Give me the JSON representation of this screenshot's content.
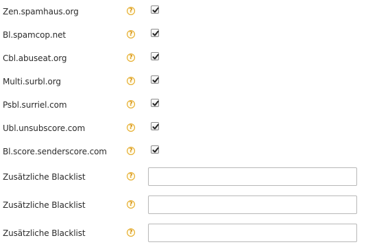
{
  "blacklists": [
    {
      "label": "Zen.spamhaus.org",
      "checked": true,
      "help_icon": "question-circle-icon"
    },
    {
      "label": "Bl.spamcop.net",
      "checked": true,
      "help_icon": "question-circle-icon"
    },
    {
      "label": "Cbl.abuseat.org",
      "checked": true,
      "help_icon": "question-circle-icon"
    },
    {
      "label": "Multi.surbl.org",
      "checked": true,
      "help_icon": "question-circle-icon"
    },
    {
      "label": "Psbl.surriel.com",
      "checked": true,
      "help_icon": "question-circle-icon"
    },
    {
      "label": "Ubl.unsubscore.com",
      "checked": true,
      "help_icon": "question-circle-icon"
    },
    {
      "label": "Bl.score.senderscore.com",
      "checked": true,
      "help_icon": "question-circle-icon"
    }
  ],
  "additional": [
    {
      "label": "Zusätzliche Blacklist",
      "value": "",
      "placeholder": "",
      "help_icon": "question-circle-icon"
    },
    {
      "label": "Zusätzliche Blacklist",
      "value": "",
      "placeholder": "",
      "help_icon": "question-circle-icon"
    },
    {
      "label": "Zusätzliche Blacklist",
      "value": "",
      "placeholder": "",
      "help_icon": "question-circle-icon"
    }
  ],
  "help_glyph": "?",
  "colors": {
    "help_icon": "#e3a519",
    "text": "#2b2b2b",
    "input_border": "#b7b7b7"
  }
}
